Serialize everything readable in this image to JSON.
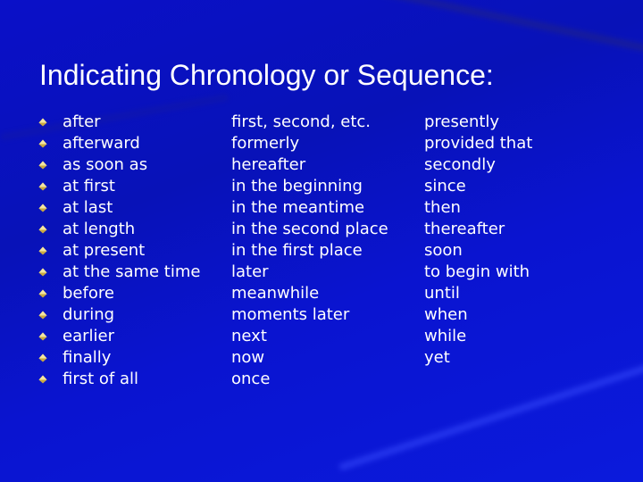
{
  "slide": {
    "title": "Indicating Chronology or Sequence:",
    "bullet_icon": "gold-diamond-bullet",
    "colors": {
      "background": "#0a12c8",
      "text": "#ffffff",
      "bullet": "#d8c060"
    },
    "columns": [
      [
        "after",
        "afterward",
        "as soon as",
        "at first",
        "at last",
        "at length",
        "at present",
        "at the same time",
        "before",
        "during",
        "earlier",
        "finally",
        "first of all"
      ],
      [
        "first, second, etc.",
        "formerly",
        "hereafter",
        "in the beginning",
        "in the meantime",
        "in the second place",
        "in the first place",
        "later",
        "meanwhile",
        "moments later",
        "next",
        "now",
        "once"
      ],
      [
        "presently",
        "provided that",
        "secondly",
        "since",
        "then",
        "thereafter",
        "soon",
        "to begin with",
        "until",
        "when",
        "while",
        "yet"
      ]
    ]
  }
}
